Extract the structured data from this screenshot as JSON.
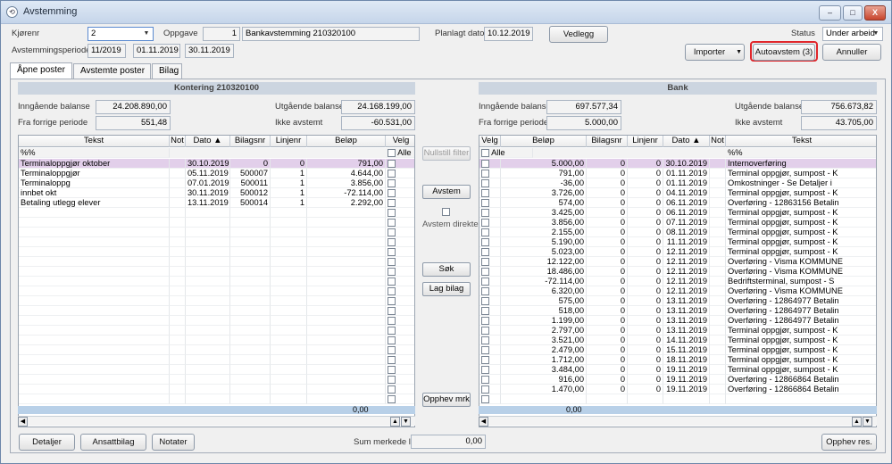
{
  "window": {
    "title": "Avstemming",
    "app_icon": "circle-arrow-icon",
    "min_label": "–",
    "max_label": "□",
    "close_label": "X"
  },
  "header": {
    "kjorenr_label": "Kjørenr",
    "kjorenr_value": "2",
    "oppgave_label": "Oppgave",
    "oppgave_num": "1",
    "oppgave_text": "Bankavstemming 210320100",
    "planlagt_label": "Planlagt dato",
    "planlagt_value": "10.12.2019",
    "vedlegg_label": "Vedlegg",
    "status_label": "Status",
    "status_value": "Under arbeid",
    "periode_label": "Avstemmingsperiode",
    "periode_value": "11/2019",
    "periode_from": "01.11.2019",
    "periode_to": "30.11.2019",
    "importer_label": "Importer",
    "autoavstem_label": "Autoavstem (3)",
    "annuller_label": "Annuller",
    "highlight_color": "#e0262b"
  },
  "tabs": [
    "Åpne poster",
    "Avstemte poster",
    "Bilag"
  ],
  "left": {
    "title": "Kontering 210320100",
    "inngaende_label": "Inngående balanse",
    "inngaende_value": "24.208.890,00",
    "forrige_label": "Fra forrige periode",
    "forrige_value": "551,48",
    "utgaende_label": "Utgående balanse",
    "utgaende_value": "24.168.199,00",
    "ikke_label": "Ikke avstemt",
    "ikke_value": "-60.531,00",
    "columns": [
      "Tekst",
      "Not",
      "Dato",
      "Bilagsnr",
      "Linjenr",
      "Beløp",
      "Velg"
    ],
    "filter_text": "%%",
    "alle_label": "Alle",
    "rows": [
      [
        "Terminaloppgjør oktober",
        "",
        "30.10.2019",
        "0",
        "0",
        "791,00"
      ],
      [
        "Terminaloppgjør",
        "",
        "05.11.2019",
        "500007",
        "1",
        "4.644,00"
      ],
      [
        "Terminaloppg",
        "",
        "07.01.2019",
        "500011",
        "1",
        "3.856,00"
      ],
      [
        "innbet okt",
        "",
        "30.11.2019",
        "500012",
        "1",
        "-72.114,00"
      ],
      [
        "Betaling utlegg elever",
        "",
        "13.11.2019",
        "500014",
        "1",
        "2.292,00"
      ]
    ],
    "sum_value": "0,00"
  },
  "middle": {
    "nullstill_label": "Nullstill filter",
    "avstem_label": "Avstem",
    "avstem_direkte_label": "Avstem direkte",
    "sok_label": "Søk",
    "lag_bilag_label": "Lag bilag",
    "opphev_mrk_label": "Opphev mrk"
  },
  "right": {
    "title": "Bank",
    "inngaende_label": "Inngående balanse",
    "inngaende_value": "697.577,34",
    "forrige_label": "Fra forrige periode",
    "forrige_value": "5.000,00",
    "utgaende_label": "Utgående balanse",
    "utgaende_value": "756.673,82",
    "ikke_label": "Ikke avstemt",
    "ikke_value": "43.705,00",
    "columns": [
      "Velg",
      "Beløp",
      "Bilagsnr",
      "Linjenr",
      "Dato",
      "Not",
      "Tekst"
    ],
    "filter_text": "%%",
    "alle_label": "Alle",
    "rows": [
      [
        "5.000,00",
        "0",
        "0",
        "30.10.2019",
        "",
        "Internoverføring"
      ],
      [
        "791,00",
        "0",
        "0",
        "01.11.2019",
        "",
        "Terminal oppgjør, sumpost - K"
      ],
      [
        "-36,00",
        "0",
        "0",
        "01.11.2019",
        "",
        "Omkostninger - Se Detaljer i"
      ],
      [
        "3.726,00",
        "0",
        "0",
        "04.11.2019",
        "",
        "Terminal oppgjør, sumpost - K"
      ],
      [
        "574,00",
        "0",
        "0",
        "06.11.2019",
        "",
        "Overføring - 12863156 Betalin"
      ],
      [
        "3.425,00",
        "0",
        "0",
        "06.11.2019",
        "",
        "Terminal oppgjør, sumpost - K"
      ],
      [
        "3.856,00",
        "0",
        "0",
        "07.11.2019",
        "",
        "Terminal oppgjør, sumpost - K"
      ],
      [
        "2.155,00",
        "0",
        "0",
        "08.11.2019",
        "",
        "Terminal oppgjør, sumpost - K"
      ],
      [
        "5.190,00",
        "0",
        "0",
        "11.11.2019",
        "",
        "Terminal oppgjør, sumpost - K"
      ],
      [
        "5.023,00",
        "0",
        "0",
        "12.11.2019",
        "",
        "Terminal oppgjør, sumpost - K"
      ],
      [
        "12.122,00",
        "0",
        "0",
        "12.11.2019",
        "",
        "Overføring - Visma KOMMUNE"
      ],
      [
        "18.486,00",
        "0",
        "0",
        "12.11.2019",
        "",
        "Overføring - Visma KOMMUNE"
      ],
      [
        "-72.114,00",
        "0",
        "0",
        "12.11.2019",
        "",
        "Bedriftsterminal, sumpost - S"
      ],
      [
        "6.320,00",
        "0",
        "0",
        "12.11.2019",
        "",
        "Overføring - Visma KOMMUNE"
      ],
      [
        "575,00",
        "0",
        "0",
        "13.11.2019",
        "",
        "Overføring - 12864977 Betalin"
      ],
      [
        "518,00",
        "0",
        "0",
        "13.11.2019",
        "",
        "Overføring - 12864977 Betalin"
      ],
      [
        "1.199,00",
        "0",
        "0",
        "13.11.2019",
        "",
        "Overføring - 12864977 Betalin"
      ],
      [
        "2.797,00",
        "0",
        "0",
        "13.11.2019",
        "",
        "Terminal oppgjør, sumpost - K"
      ],
      [
        "3.521,00",
        "0",
        "0",
        "14.11.2019",
        "",
        "Terminal oppgjør, sumpost - K"
      ],
      [
        "2.479,00",
        "0",
        "0",
        "15.11.2019",
        "",
        "Terminal oppgjør, sumpost - K"
      ],
      [
        "1.712,00",
        "0",
        "0",
        "18.11.2019",
        "",
        "Terminal oppgjør, sumpost - K"
      ],
      [
        "3.484,00",
        "0",
        "0",
        "19.11.2019",
        "",
        "Terminal oppgjør, sumpost - K"
      ],
      [
        "916,00",
        "0",
        "0",
        "19.11.2019",
        "",
        "Overføring - 12866864 Betalin"
      ],
      [
        "1.470,00",
        "0",
        "0",
        "19.11.2019",
        "",
        "Overføring - 12866864 Betalin"
      ]
    ],
    "sum_value": "0,00"
  },
  "footer": {
    "detaljer_label": "Detaljer",
    "ansattbilag_label": "Ansattbilag",
    "notater_label": "Notater",
    "sum_label": "Sum merkede linjer",
    "sum_value": "0,00",
    "opphev_res_label": "Opphev res."
  }
}
